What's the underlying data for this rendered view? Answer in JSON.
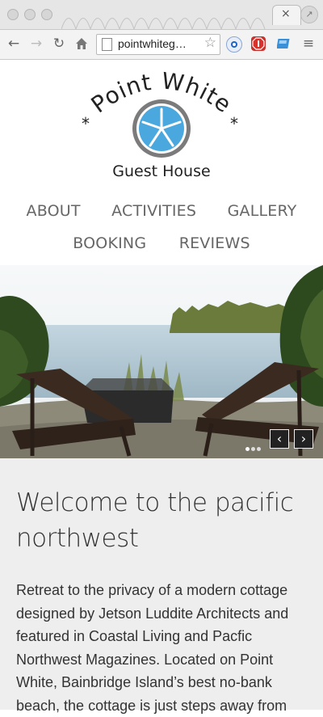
{
  "browser": {
    "url": "pointwhiteg…",
    "tab_close": "×",
    "back_icon": "←",
    "forward_icon": "→",
    "reload_icon": "↻",
    "menu_icon": "≡"
  },
  "logo": {
    "title": "Point White",
    "subtitle": "Guest House"
  },
  "nav": {
    "items": [
      {
        "label": "ABOUT"
      },
      {
        "label": "ACTIVITIES"
      },
      {
        "label": "GALLERY"
      },
      {
        "label": "BOOKING"
      },
      {
        "label": "REVIEWS"
      }
    ]
  },
  "slider": {
    "prev": "‹",
    "next": "›"
  },
  "main": {
    "heading": "Welcome to the pacific northwest",
    "body": "Retreat to the privacy of a modern cottage designed by Jetson Luddite Architects and featured in Coastal Living and Pacfic Northwest Magazines. Located on Point White, Bainbridge Island’s best no-bank beach, the cottage is just steps away from"
  },
  "colors": {
    "accent": "#4aa8de",
    "nav_text": "#666666",
    "content_bg": "#eeeeee"
  }
}
